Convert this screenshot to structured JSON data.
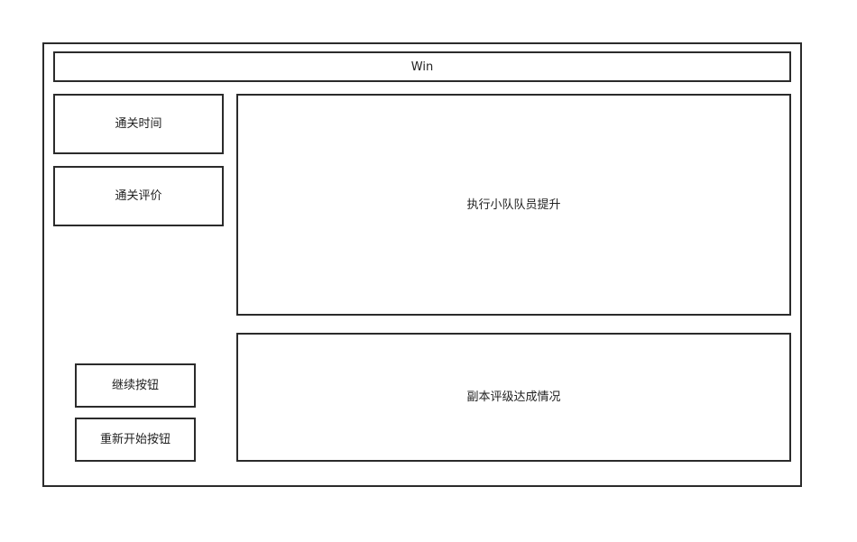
{
  "window": {
    "title": "Win"
  },
  "left_panel": {
    "clear_time": "通关时间",
    "clear_rating": "通关评价"
  },
  "main_panel": {
    "team_upgrade": "执行小队队员提升",
    "dungeon_rating": "副本评级达成情况"
  },
  "buttons": {
    "continue_label": "继续按钮",
    "restart_label": "重新开始按钮"
  },
  "colors": {
    "border": "#2b2b2b",
    "background": "#ffffff"
  }
}
